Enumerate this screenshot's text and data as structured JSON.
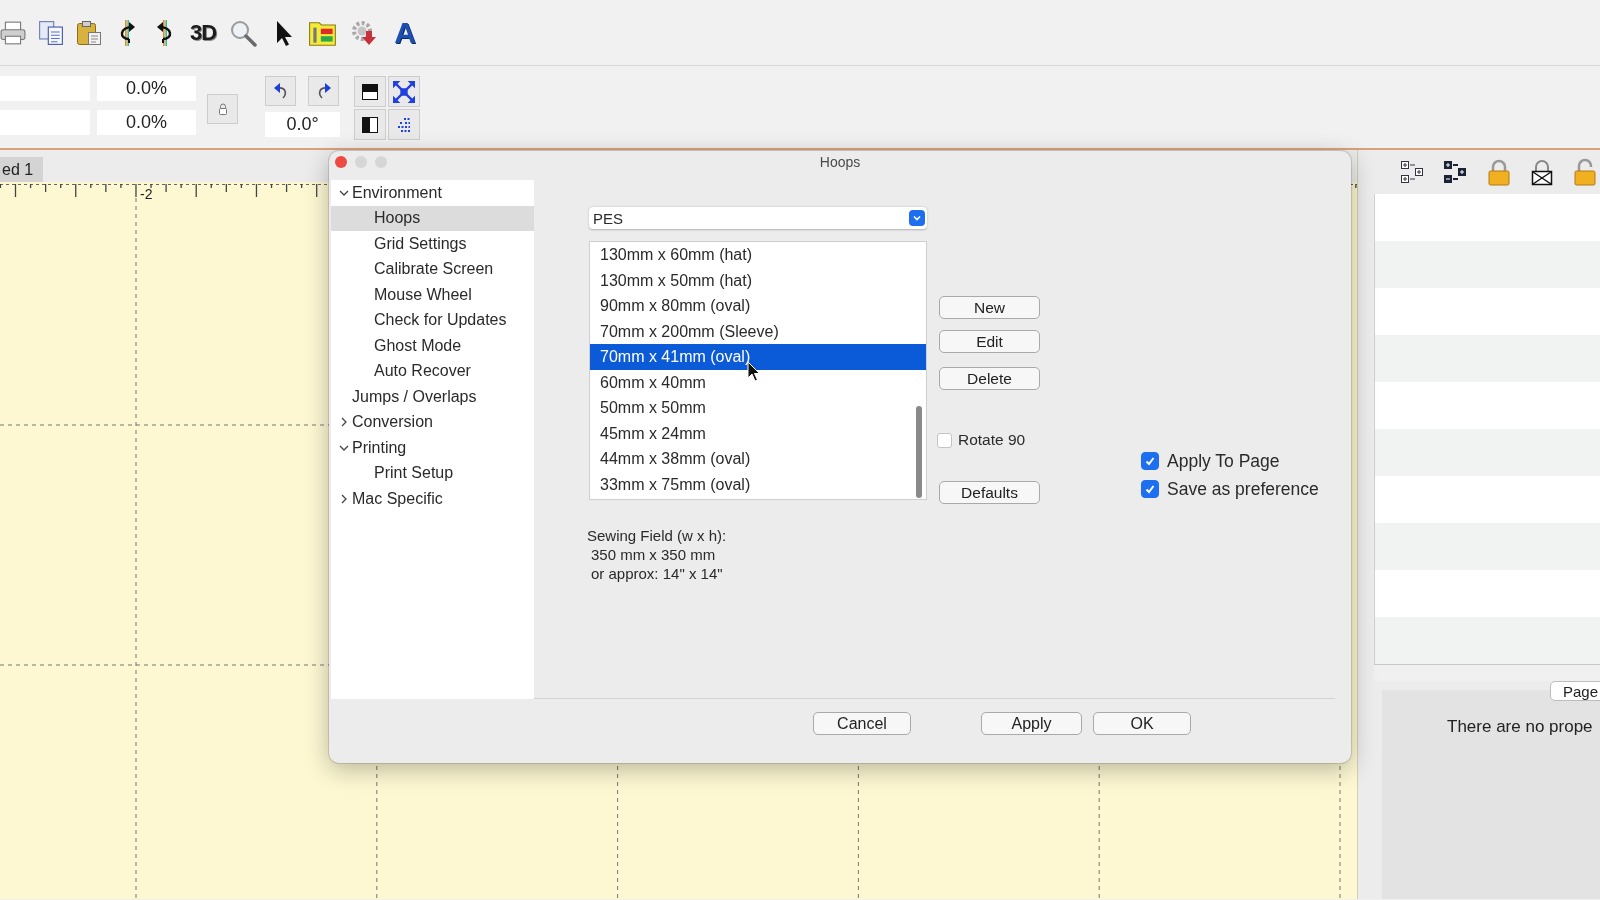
{
  "toolbar": {
    "three_d": "3D",
    "text_tool": "A"
  },
  "transform": {
    "scale": [
      "0.0%",
      "0.0%"
    ],
    "rotation": "0.0°"
  },
  "document_tab": {
    "label": "ed 1"
  },
  "ruler": {
    "labels": [
      "-2"
    ]
  },
  "dialog": {
    "title": "Hoops",
    "tree": [
      {
        "label": "Environment",
        "expanded": true,
        "selected": false,
        "children": [
          {
            "label": "Hoops",
            "selected": true
          },
          {
            "label": "Grid Settings",
            "selected": false
          },
          {
            "label": "Calibrate Screen",
            "selected": false
          },
          {
            "label": "Mouse Wheel",
            "selected": false
          },
          {
            "label": "Check for Updates",
            "selected": false
          },
          {
            "label": "Ghost Mode",
            "selected": false
          },
          {
            "label": "Auto Recover",
            "selected": false
          }
        ]
      },
      {
        "label": "Jumps / Overlaps",
        "selected": false
      },
      {
        "label": "Conversion",
        "expanded": false,
        "selected": false
      },
      {
        "label": "Printing",
        "expanded": true,
        "selected": false,
        "children": [
          {
            "label": "Print Setup",
            "selected": false
          }
        ]
      },
      {
        "label": "Mac Specific",
        "expanded": false,
        "selected": false
      }
    ],
    "format": {
      "value": "PES"
    },
    "hoops": [
      {
        "label": "130mm x 60mm (hat)",
        "selected": false
      },
      {
        "label": "130mm x 50mm (hat)",
        "selected": false
      },
      {
        "label": "90mm x 80mm (oval)",
        "selected": false
      },
      {
        "label": "70mm x 200mm (Sleeve)",
        "selected": false
      },
      {
        "label": "70mm x 41mm (oval)",
        "selected": true
      },
      {
        "label": "60mm x 40mm",
        "selected": false
      },
      {
        "label": "50mm x 50mm",
        "selected": false
      },
      {
        "label": "45mm x 24mm",
        "selected": false
      },
      {
        "label": "44mm x 38mm (oval)",
        "selected": false
      },
      {
        "label": "33mm x 75mm (oval)",
        "selected": false
      }
    ],
    "buttons": {
      "new": "New",
      "edit": "Edit",
      "delete": "Delete",
      "defaults": "Defaults"
    },
    "rotate": {
      "label": "Rotate 90",
      "checked": false
    },
    "options": [
      {
        "label": "Apply To Page",
        "checked": true
      },
      {
        "label": "Save as preference",
        "checked": true
      }
    ],
    "sewing_field": [
      "Sewing Field (w x h):",
      "350 mm x 350 mm",
      "or approx: 14\" x 14\""
    ],
    "footer": {
      "cancel": "Cancel",
      "apply": "Apply",
      "ok": "OK"
    }
  },
  "side_panel": {
    "page_button": "Page",
    "message": "There are no prope"
  }
}
